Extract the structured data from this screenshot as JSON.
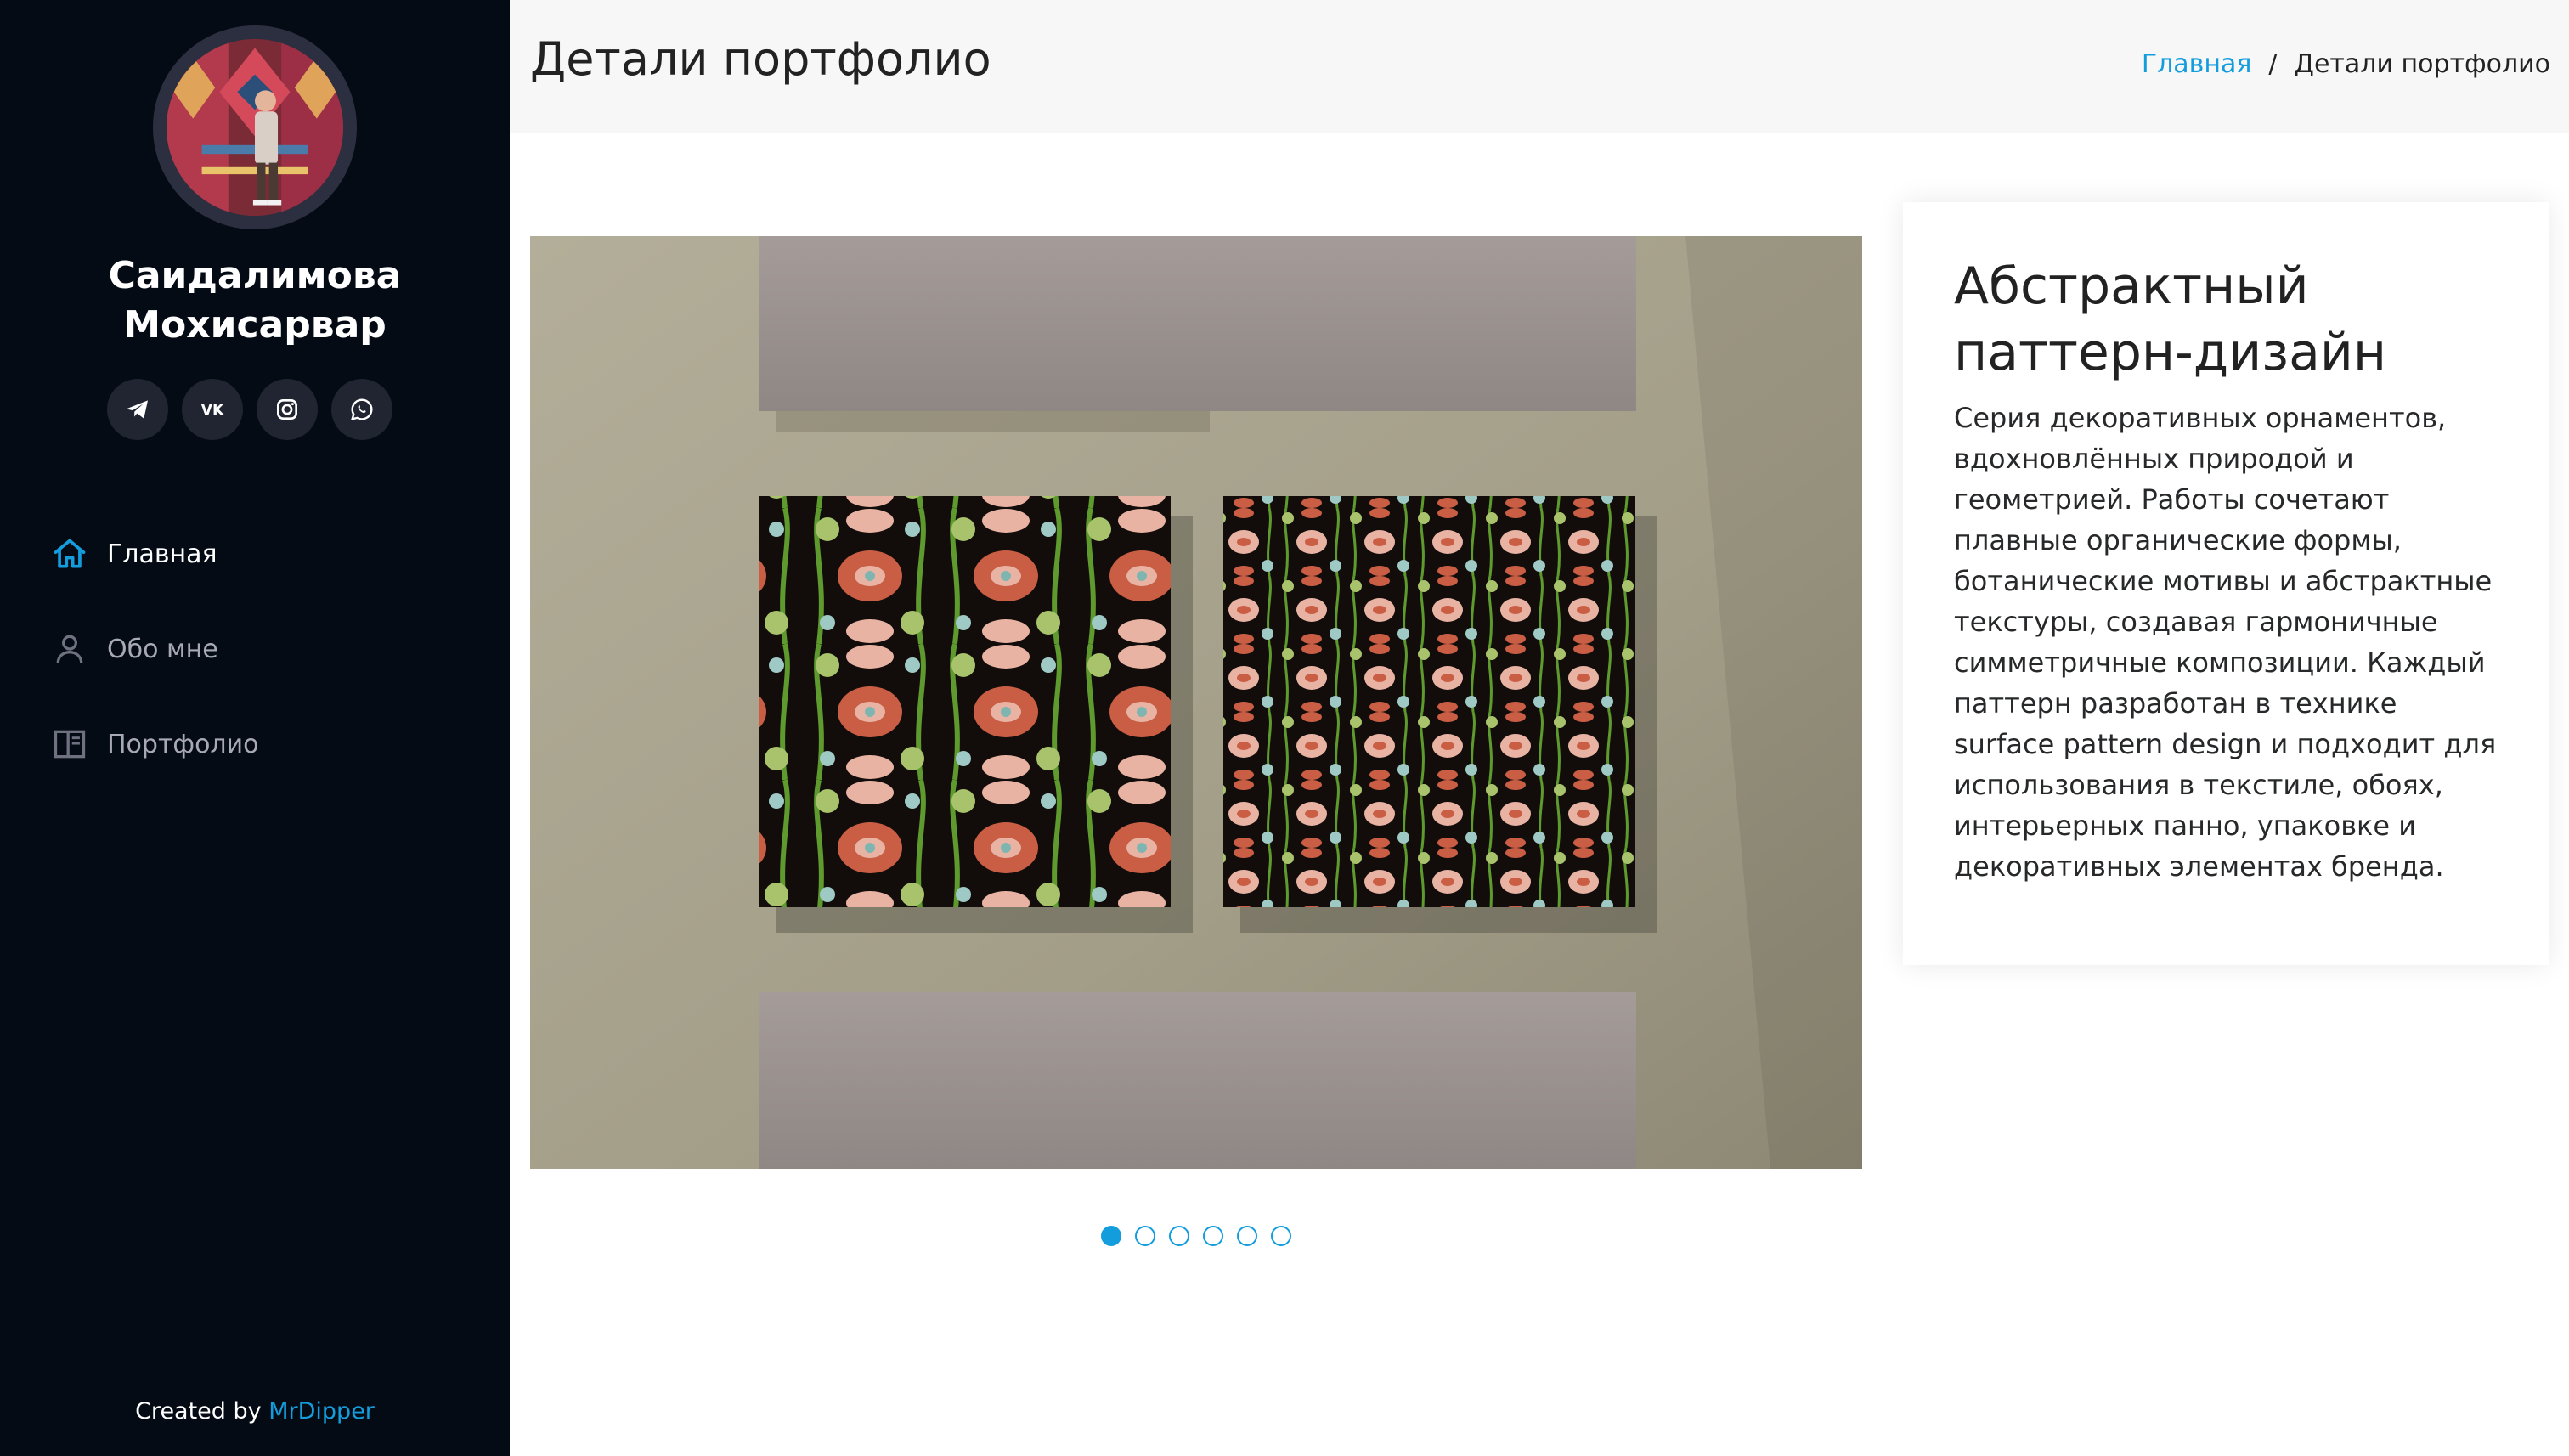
{
  "sidebar": {
    "avatar_icon": "profile-photo",
    "name_line1": "Саидалимова",
    "name_line2": "Мохисарвар",
    "socials": [
      {
        "name": "telegram",
        "icon": "telegram-icon"
      },
      {
        "name": "vk",
        "icon": "vk-icon",
        "label": "VK"
      },
      {
        "name": "instagram",
        "icon": "instagram-icon"
      },
      {
        "name": "whatsapp",
        "icon": "whatsapp-icon"
      }
    ],
    "nav": [
      {
        "label": "Главная",
        "icon": "home-icon",
        "active": true
      },
      {
        "label": "Обо мне",
        "icon": "person-icon",
        "active": false
      },
      {
        "label": "Портфолио",
        "icon": "portfolio-icon",
        "active": false
      }
    ],
    "credits_prefix": "Created by",
    "credits_link": "MrDipper"
  },
  "header": {
    "title": "Детали портфолио",
    "breadcrumb": {
      "home": "Главная",
      "separator": "/",
      "current": "Детали портфолио"
    }
  },
  "slider": {
    "total_slides": 6,
    "active_index": 0
  },
  "info": {
    "title": "Абстрактный паттерн-дизайн",
    "description": "Серия декоративных орнаментов, вдохновлённых природой и геометрией. Работы сочетают плавные органические формы, ботанические мотивы и абстрактные текстуры, создавая гармоничные симметричные композиции. Каждый паттерн разработан в технике surface pattern design и подходит для использования в текстиле, обоях, интерьерных панно, упаковке и декоративных элементах бренда."
  },
  "colors": {
    "sidebar_bg": "#040b14",
    "accent": "#149ddd",
    "header_bg": "#f7f7f7"
  }
}
